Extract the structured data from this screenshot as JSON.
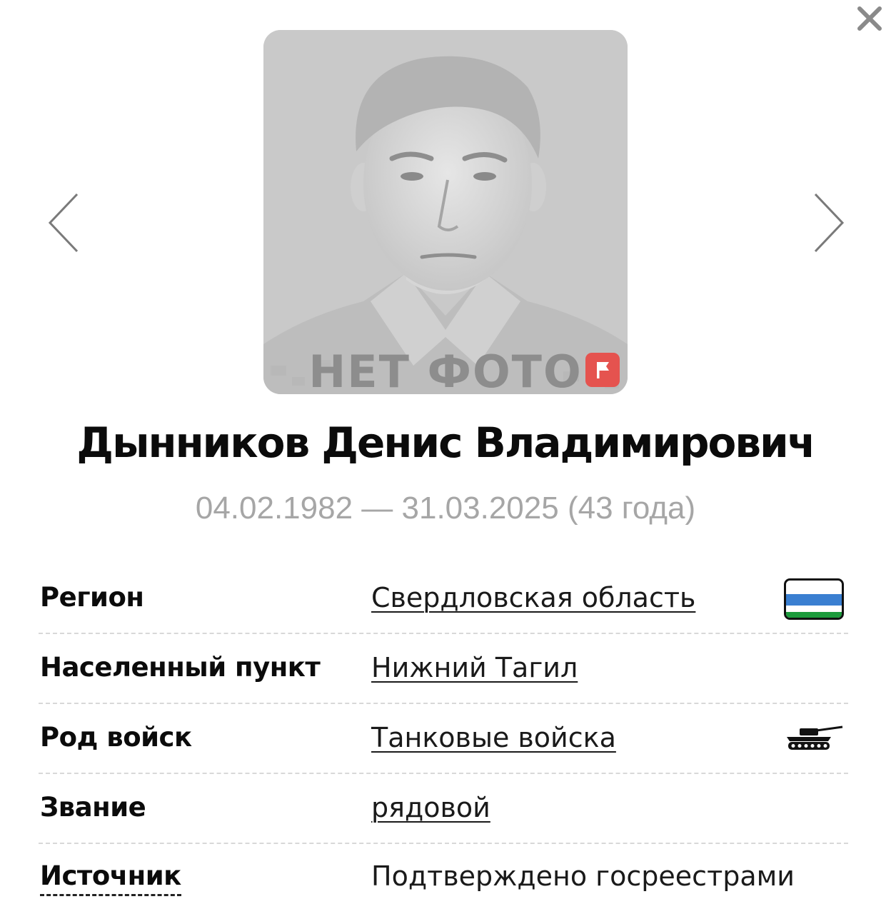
{
  "photo": {
    "placeholder_text": "НЕТ ФОТО",
    "report_icon": "flag-icon"
  },
  "navigation": {
    "prev_icon": "chevron-left-icon",
    "next_icon": "chevron-right-icon",
    "close_icon": "close-icon"
  },
  "person": {
    "name": "Дынников Денис Владимирович",
    "dates": "04.02.1982 — 31.03.2025 (43 года)"
  },
  "details": [
    {
      "label": "Регион",
      "value": "Свердловская область",
      "icon": "region-flag-icon",
      "flag_colors": [
        "#ffffff",
        "#3a7fd1",
        "#1c9b3c"
      ]
    },
    {
      "label": "Населенный пункт",
      "value": "Нижний Тагил"
    },
    {
      "label": "Род войск",
      "value": "Танковые войска",
      "icon": "tank-icon"
    },
    {
      "label": "Звание",
      "value": "рядовой"
    },
    {
      "label": "Источник",
      "value": "Подтверждено госреестрами"
    }
  ],
  "colors": {
    "report_button": "#e5534f",
    "dates_text": "#a6a6a6",
    "photo_background": "#c9c9c9"
  }
}
